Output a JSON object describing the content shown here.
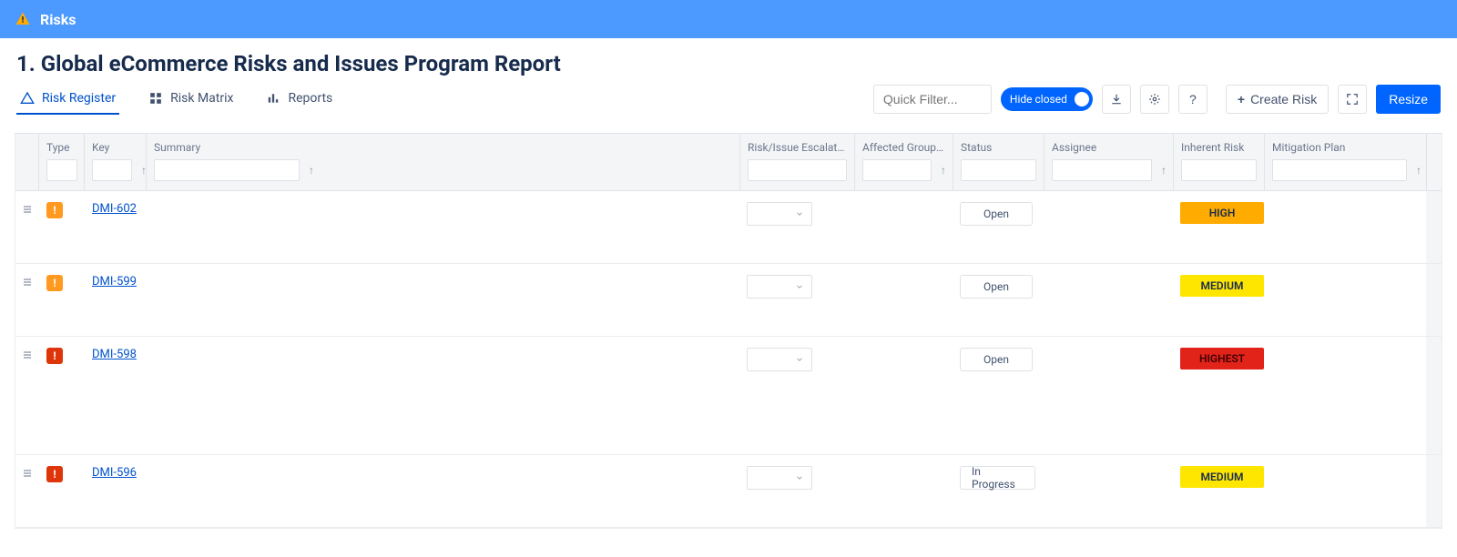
{
  "banner": {
    "title": "Risks"
  },
  "page_title": {
    "number": "1.",
    "text": "Global eCommerce Risks and Issues Program Report"
  },
  "tabs": [
    {
      "key": "register",
      "label": "Risk Register",
      "active": true
    },
    {
      "key": "matrix",
      "label": "Risk Matrix",
      "active": false
    },
    {
      "key": "reports",
      "label": "Reports",
      "active": false
    }
  ],
  "toolbar": {
    "quick_filter_placeholder": "Quick Filter...",
    "hide_closed_label": "Hide closed",
    "create_label": "Create Risk",
    "resize_label": "Resize",
    "help_label": "?"
  },
  "columns": {
    "type": "Type",
    "key": "Key",
    "summary": "Summary",
    "escalation": "Risk/Issue Escalation Level",
    "groups": "Affected Group(s)",
    "status": "Status",
    "assignee": "Assignee",
    "inherent": "Inherent Risk",
    "mitigation": "Mitigation Plan"
  },
  "rows": [
    {
      "type_color": "orange",
      "key": "DMI-602",
      "status": "Open",
      "risk": "HIGH",
      "risk_class": "risk-high",
      "h": "h-80"
    },
    {
      "type_color": "orange",
      "key": "DMI-599",
      "status": "Open",
      "risk": "MEDIUM",
      "risk_class": "risk-medium",
      "h": "h-80"
    },
    {
      "type_color": "red",
      "key": "DMI-598",
      "status": "Open",
      "risk": "HIGHEST",
      "risk_class": "risk-highest",
      "h": "h-140"
    },
    {
      "type_color": "red",
      "key": "DMI-596",
      "status": "In Progress",
      "risk": "MEDIUM",
      "risk_class": "risk-medium",
      "h": "h-80"
    }
  ]
}
